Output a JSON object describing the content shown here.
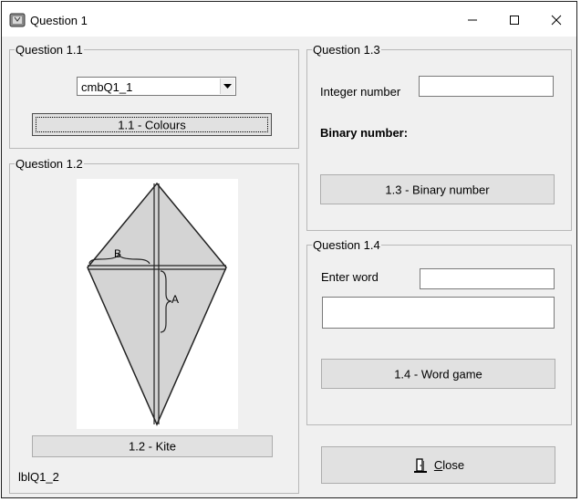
{
  "window": {
    "title": "Question 1"
  },
  "q11": {
    "legend": "Question 1.1",
    "combo_value": "cmbQ1_1",
    "colours_button": "1.1 - Colours"
  },
  "q12": {
    "legend": "Question 1.2",
    "kite_labels": {
      "a": "A",
      "b": "B"
    },
    "kite_button": "1.2 - Kite",
    "status_label": "lblQ1_2"
  },
  "q13": {
    "legend": "Question 1.3",
    "integer_label": "Integer number",
    "integer_value": "",
    "binary_label": "Binary number:",
    "binary_button": "1.3 - Binary number"
  },
  "q14": {
    "legend": "Question 1.4",
    "enter_word_label": "Enter word",
    "word_value": "",
    "output_value": "",
    "word_button": "1.4 - Word game"
  },
  "close": {
    "first_letter": "C",
    "rest": "lose"
  }
}
